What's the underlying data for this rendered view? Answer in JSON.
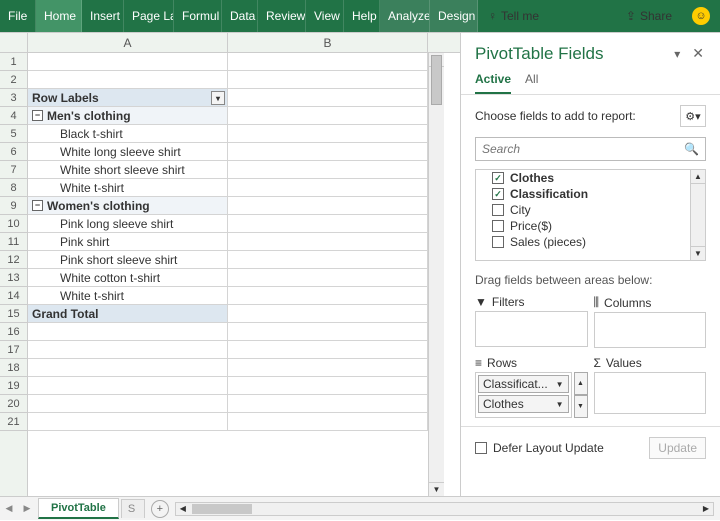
{
  "ribbon": {
    "tabs": [
      "File",
      "Home",
      "Insert",
      "Page La",
      "Formul",
      "Data",
      "Review",
      "View",
      "Help",
      "Analyze",
      "Design"
    ],
    "tell_me": "Tell me",
    "share": "Share"
  },
  "columns": [
    "A",
    "B"
  ],
  "row_numbers": [
    "1",
    "2",
    "3",
    "4",
    "5",
    "6",
    "7",
    "8",
    "9",
    "10",
    "11",
    "12",
    "13",
    "14",
    "15",
    "16",
    "17",
    "18",
    "19",
    "20",
    "21"
  ],
  "pivot": {
    "header": "Row Labels",
    "groups": [
      {
        "label": "Men's clothing",
        "items": [
          "Black t-shirt",
          "White long sleeve shirt",
          "White short sleeve shirt",
          "White t-shirt"
        ]
      },
      {
        "label": "Women's clothing",
        "items": [
          "Pink long sleeve shirt",
          "Pink shirt",
          "Pink short sleeve shirt",
          "White cotton t-shirt",
          "White t-shirt"
        ]
      }
    ],
    "total": "Grand Total"
  },
  "pane": {
    "title": "PivotTable Fields",
    "tabs": {
      "active": "Active",
      "all": "All"
    },
    "choose": "Choose fields to add to report:",
    "search_placeholder": "Search",
    "fields": [
      {
        "label": "Clothes",
        "checked": true
      },
      {
        "label": "Classification",
        "checked": true
      },
      {
        "label": "City",
        "checked": false
      },
      {
        "label": "Price($)",
        "checked": false
      },
      {
        "label": "Sales (pieces)",
        "checked": false
      }
    ],
    "drag": "Drag fields between areas below:",
    "areas": {
      "filters": "Filters",
      "columns": "Columns",
      "rows": "Rows",
      "values": "Values"
    },
    "row_pills": [
      "Classificat...",
      "Clothes"
    ],
    "defer": "Defer Layout Update",
    "update": "Update"
  },
  "sheets": {
    "active": "PivotTable",
    "other": "S"
  }
}
